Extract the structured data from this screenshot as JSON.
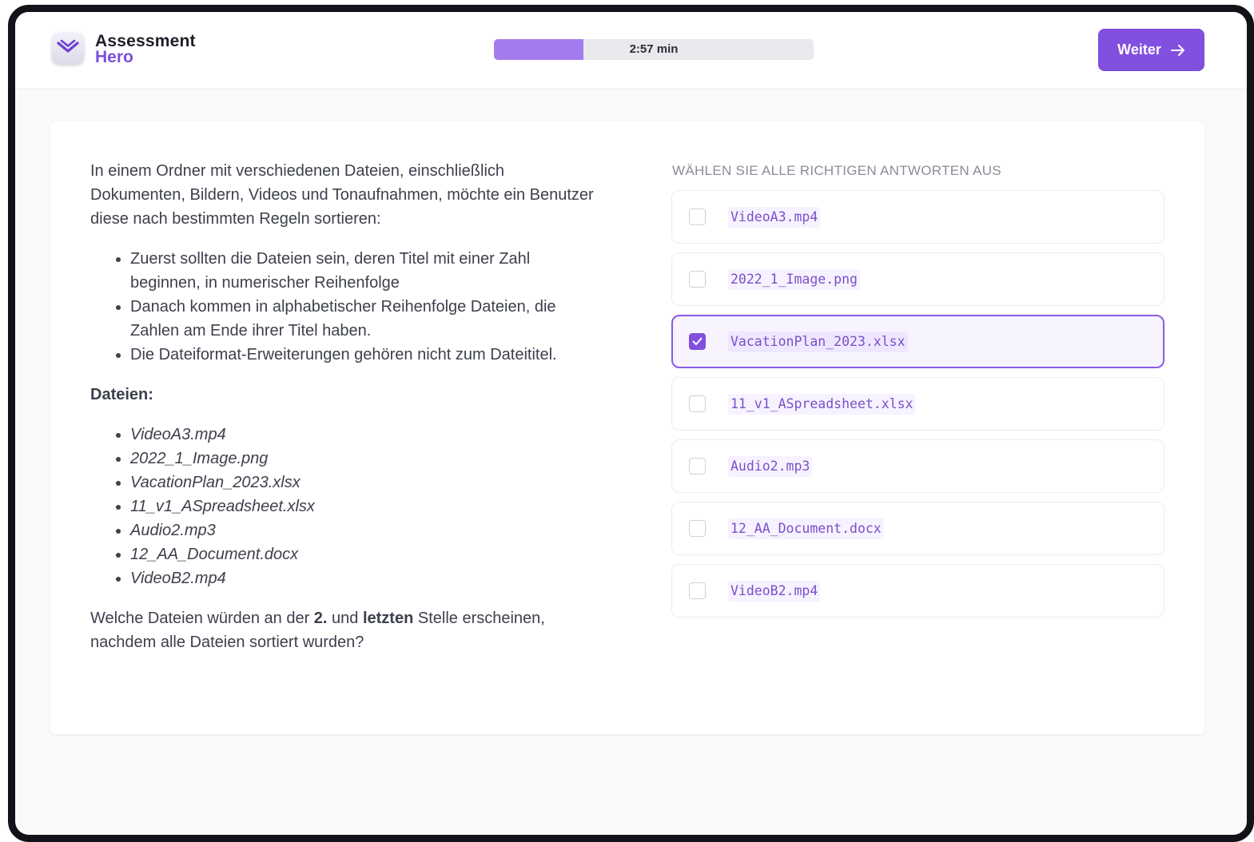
{
  "brand": {
    "line1": "Assessment",
    "line2": "Hero"
  },
  "timer": {
    "text": "2:57 min",
    "progress": 0.28
  },
  "next_button": {
    "label": "Weiter"
  },
  "question": {
    "intro": "In einem Ordner mit verschiedenen Dateien, einschließlich Dokumenten, Bildern, Videos und Tonaufnahmen, möchte ein Benutzer diese nach bestimmten Regeln sortieren:",
    "rules": [
      "Zuerst sollten die Dateien sein, deren Titel mit einer Zahl beginnen, in numerischer Reihenfolge",
      "Danach kommen in alphabetischer Reihenfolge Dateien, die Zahlen am Ende ihrer Titel haben.",
      "Die Dateiformat-Erweiterungen gehören nicht zum Dateititel."
    ],
    "files_heading": "Dateien:",
    "files": [
      "VideoA3.mp4",
      "2022_1_Image.png",
      "VacationPlan_2023.xlsx",
      "11_v1_ASpreadsheet.xlsx",
      "Audio2.mp3",
      "12_AA_Document.docx",
      "VideoB2.mp4"
    ],
    "closing": {
      "part1": "Welche Dateien würden an der ",
      "bold1": "2.",
      "part2": " und ",
      "bold2": "letzten",
      "part3": " Stelle erscheinen, nachdem alle Dateien sortiert wurden?"
    }
  },
  "answers": {
    "instruction": "WÄHLEN SIE ALLE RICHTIGEN ANTWORTEN AUS",
    "options": [
      {
        "label": "VideoA3.mp4",
        "checked": false
      },
      {
        "label": "2022_1_Image.png",
        "checked": false
      },
      {
        "label": "VacationPlan_2023.xlsx",
        "checked": true
      },
      {
        "label": "11_v1_ASpreadsheet.xlsx",
        "checked": false
      },
      {
        "label": "Audio2.mp3",
        "checked": false
      },
      {
        "label": "12_AA_Document.docx",
        "checked": false
      },
      {
        "label": "VideoB2.mp4",
        "checked": false
      }
    ]
  },
  "colors": {
    "accent": "#8250df",
    "timer_fill": "#a47bec",
    "selected_bg": "#f8f4ff",
    "code_text": "#7b4fc9"
  }
}
